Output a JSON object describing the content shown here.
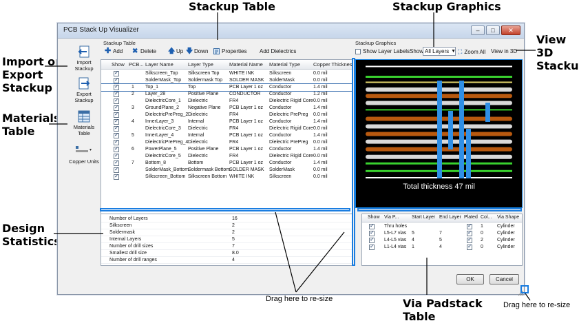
{
  "callouts": {
    "stackup_table": "Stackup Table",
    "stackup_graphics": "Stackup Graphics",
    "import_export_1": "Import or",
    "import_export_2": "Export",
    "import_export_3": "Stackup",
    "materials_1": "Materials",
    "materials_2": "Table",
    "view3d_1": "View",
    "view3d_2": "3D",
    "view3d_3": "Stackup",
    "design_1": "Design",
    "design_2": "Statistics",
    "via_1": "Via Padstack",
    "via_2": "Table",
    "drag1": "Drag here to re-size",
    "drag2": "Drag here to re-size"
  },
  "window": {
    "title": "PCB Stack Up Visualizer",
    "min": "–",
    "max": "□",
    "close": "✕"
  },
  "left_panel": {
    "import": "Import Stackup",
    "export": "Export Stackup",
    "materials": "Materials Table",
    "copper_units": "Copper Units"
  },
  "stackup_section": "Stackup Table",
  "graphics_section": "Stackup Graphics",
  "toolbar": {
    "add": "Add",
    "delete": "Delete",
    "up": "Up",
    "down": "Down",
    "properties": "Properties",
    "add_dielectrics": "Add Dielectrics"
  },
  "graphics_toolbar": {
    "show_layer_labels": "Show Layer Labels",
    "show": "Show",
    "show_value": "All Layers",
    "zoom_all": "Zoom All",
    "view_3d": "View in 3D"
  },
  "stackup_columns": [
    "Show",
    "PCB...",
    "Layer Name",
    "Layer Type",
    "Material Name",
    "Material Type",
    "Copper Thickness"
  ],
  "stackup_rows": [
    {
      "pcb": "",
      "name": "Silkscreen_Top",
      "type": "Silkscreen Top",
      "material": "WHITE INK",
      "mtype": "Silkscreen",
      "thick": "0.0 mil"
    },
    {
      "pcb": "",
      "name": "SolderMask_Top",
      "type": "Soldermask Top",
      "material": "SOLDER MASK",
      "mtype": "SolderMask",
      "thick": "0.0 mil"
    },
    {
      "pcb": "1",
      "name": "Top_1",
      "type": "Top",
      "material": "PCB Layer 1 oz",
      "mtype": "Conductor",
      "thick": "1.4 mil"
    },
    {
      "pcb": "2",
      "name": "Layer_28",
      "type": "Positive Plane",
      "material": "CONDUCTOR",
      "mtype": "Conductor",
      "thick": "1.2 mil"
    },
    {
      "pcb": "",
      "name": "DielectricCore_1",
      "type": "Dielectric",
      "material": "FR4",
      "mtype": "Dielectric Rigid Core",
      "thick": "0.0 mil"
    },
    {
      "pcb": "3",
      "name": "GroundPlane_2",
      "type": "Negative Plane",
      "material": "PCB Layer 1 oz",
      "mtype": "Conductor",
      "thick": "1.4 mil"
    },
    {
      "pcb": "",
      "name": "DielectricPrePreg_2",
      "type": "Dielectric",
      "material": "FR4",
      "mtype": "Dielectric PrePreg",
      "thick": "0.0 mil"
    },
    {
      "pcb": "4",
      "name": "InnerLayer_3",
      "type": "Internal",
      "material": "PCB Layer 1 oz",
      "mtype": "Conductor",
      "thick": "1.4 mil"
    },
    {
      "pcb": "",
      "name": "DielectricCore_3",
      "type": "Dielectric",
      "material": "FR4",
      "mtype": "Dielectric Rigid Core",
      "thick": "0.0 mil"
    },
    {
      "pcb": "5",
      "name": "InnerLayer_4",
      "type": "Internal",
      "material": "PCB Layer 1 oz",
      "mtype": "Conductor",
      "thick": "1.4 mil"
    },
    {
      "pcb": "",
      "name": "DielectricPrePreg_4",
      "type": "Dielectric",
      "material": "FR4",
      "mtype": "Dielectric PrePreg",
      "thick": "0.0 mil"
    },
    {
      "pcb": "6",
      "name": "PowerPlane_5",
      "type": "Positive Plane",
      "material": "PCB Layer 1 oz",
      "mtype": "Conductor",
      "thick": "1.4 mil"
    },
    {
      "pcb": "",
      "name": "DielectricCore_5",
      "type": "Dielectric",
      "material": "FR4",
      "mtype": "Dielectric Rigid Core",
      "thick": "0.0 mil"
    },
    {
      "pcb": "7",
      "name": "Bottom_8",
      "type": "Bottom",
      "material": "PCB Layer 1 oz",
      "mtype": "Conductor",
      "thick": "1.4 mil"
    },
    {
      "pcb": "",
      "name": "SolderMask_Bottom",
      "type": "Soldermask Bottom",
      "material": "SOLDER MASK",
      "mtype": "SolderMask",
      "thick": "0.0 mil"
    },
    {
      "pcb": "",
      "name": "Silkscreen_Bottom",
      "type": "Silkscreen Bottom",
      "material": "WHITE INK",
      "mtype": "Silkscreen",
      "thick": "0.0 mil"
    }
  ],
  "graphics": {
    "total_label": "Total thickness 47 mil",
    "layer_colors": [
      "#ffffff",
      "#39d12e",
      "#e0d26a",
      "#d9d9d9",
      "#b8590f",
      "#d9d9d9",
      "#39d12e",
      "#b8590f",
      "#d9d9d9",
      "#b8590f",
      "#d9d9d9",
      "#b8590f",
      "#d9d9d9",
      "#39d12e",
      "#39d12e",
      "#ffffff"
    ],
    "via_color": "#2f8fe6"
  },
  "statistics": [
    {
      "label": "Number of Layers",
      "value": "16"
    },
    {
      "label": "Silkscreen",
      "value": "2"
    },
    {
      "label": "Soldermask",
      "value": "2"
    },
    {
      "label": "Internal Layers",
      "value": "5"
    },
    {
      "label": "Number of drill sizes",
      "value": "7"
    },
    {
      "label": "Smallest drill size",
      "value": "8.0"
    },
    {
      "label": "Number of drill ranges",
      "value": "4"
    }
  ],
  "via_columns": [
    "Show",
    "Via P...",
    "Start Layer",
    "End Layer",
    "Plated",
    "Col...",
    "Via Shape"
  ],
  "via_rows": [
    {
      "name": "Thru holes",
      "start": "",
      "end": "",
      "col": "1",
      "shape": "Cylinder"
    },
    {
      "name": "L5-L7 vias",
      "start": "5",
      "end": "7",
      "col": "0",
      "shape": "Cylinder"
    },
    {
      "name": "L4-L5 vias",
      "start": "4",
      "end": "5",
      "col": "2",
      "shape": "Cylinder"
    },
    {
      "name": "L1-L4 vias",
      "start": "1",
      "end": "4",
      "col": "0",
      "shape": "Cylinder"
    }
  ],
  "dialog": {
    "ok": "OK",
    "cancel": "Cancel"
  }
}
